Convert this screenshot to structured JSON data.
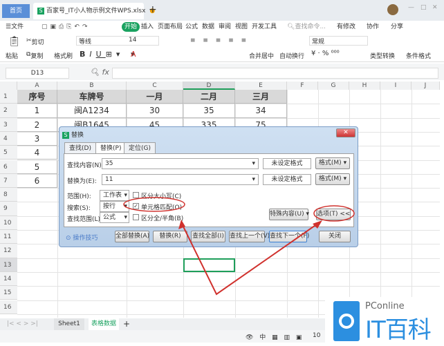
{
  "titlebar": {
    "home": "首页",
    "doc_tab": "百家号_IT小人物示例文件WPS.xlsx",
    "new_tab": "+"
  },
  "menu": {
    "file": "文件",
    "items": [
      "开始",
      "插入",
      "页面布局",
      "公式",
      "数据",
      "审阅",
      "视图",
      "开发工具"
    ],
    "search": "查找命令...",
    "changes": "有修改",
    "collab": "协作",
    "share": "分享"
  },
  "ribbon": {
    "paste": "粘贴",
    "cut": "剪切",
    "copy": "复制",
    "format_painter": "格式刷",
    "font": "等线",
    "size": "14",
    "merge": "合并居中",
    "wrap": "自动换行",
    "number_format": "常规",
    "type_convert": "类型转换",
    "cond_format": "条件格式"
  },
  "formula_bar": {
    "cell_ref": "D13",
    "fx": "fx"
  },
  "columns": [
    "A",
    "B",
    "C",
    "D",
    "E",
    "F",
    "G",
    "H",
    "I",
    "J"
  ],
  "rows": [
    "1",
    "2",
    "3",
    "4",
    "5",
    "6",
    "7",
    "8",
    "9",
    "10",
    "11",
    "12",
    "13",
    "14",
    "15",
    "16"
  ],
  "table": {
    "header": [
      "序号",
      "车牌号",
      "一月",
      "二月",
      "三月"
    ],
    "rows": [
      [
        "1",
        "闽A1234",
        "30",
        "35",
        "34"
      ],
      [
        "2",
        "闽B1645",
        "45",
        "335",
        "75"
      ],
      [
        "3"
      ],
      [
        "4"
      ],
      [
        "5"
      ],
      [
        "6"
      ]
    ]
  },
  "sheets": {
    "tabs": [
      "Sheet1",
      "表格数据"
    ],
    "add": "+"
  },
  "status": {
    "zoom": "10"
  },
  "dialog": {
    "title": "替换",
    "tabs": [
      "查找(D)",
      "替换(P)",
      "定位(G)"
    ],
    "find_label": "查找内容(N):",
    "find_value": "35",
    "replace_label": "替换为(E):",
    "replace_value": "11",
    "no_format": "未设定格式",
    "format_btn": "格式(M)",
    "scope_label": "范围(H):",
    "scope_value": "工作表",
    "case_label": "区分大小写(C)",
    "search_label": "搜索(S):",
    "search_value": "按行",
    "cell_match_label": "单元格匹配(O)",
    "lookin_label": "查找范围(L):",
    "lookin_value": "公式",
    "width_label": "区分全/半角(B)",
    "special_btn": "特殊内容(U)",
    "options_btn": "选项(T) <<",
    "tips": "操作技巧",
    "replace_all": "全部替换(A)",
    "replace": "替换(R)",
    "find_all": "查找全部(I)",
    "find_prev": "查找上一个(V)",
    "find_next": "查找下一个(F)",
    "close": "关闭",
    "case_checked": false,
    "cell_match_checked": true,
    "width_checked": false
  },
  "watermark": {
    "brand": "PConline",
    "name": "IT百科"
  },
  "colors": {
    "accent": "#1aa260",
    "annotation": "#d0312d",
    "selection": "#1e9e5a"
  }
}
